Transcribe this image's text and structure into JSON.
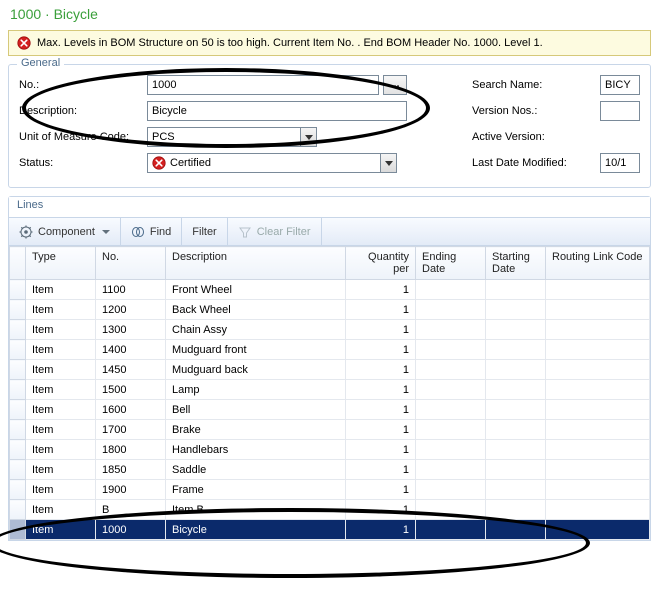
{
  "title": "1000 · Bicycle",
  "alert": "Max. Levels in BOM Structure on 50 is too high. Current Item No. . End BOM Header No. 1000. Level 1.",
  "general": {
    "legend": "General",
    "no_label": "No.:",
    "no_value": "1000",
    "description_label": "Description:",
    "description_value": "Bicycle",
    "uom_label": "Unit of Measure Code:",
    "uom_value": "PCS",
    "status_label": "Status:",
    "status_value": "Certified",
    "search_name_label": "Search Name:",
    "search_name_value": "BICY",
    "version_nos_label": "Version Nos.:",
    "version_nos_value": "",
    "active_version_label": "Active Version:",
    "active_version_value": "",
    "last_date_modified_label": "Last Date Modified:",
    "last_date_modified_value": "10/1"
  },
  "lines": {
    "legend": "Lines",
    "toolbar": {
      "component": "Component",
      "find": "Find",
      "filter": "Filter",
      "clear_filter": "Clear Filter"
    },
    "columns": {
      "type": "Type",
      "no": "No.",
      "description": "Description",
      "qty_per": "Quantity per",
      "ending_date": "Ending Date",
      "starting_date": "Starting Date",
      "routing_link_code": "Routing Link Code"
    },
    "rows": [
      {
        "type": "Item",
        "no": "1100",
        "description": "Front Wheel",
        "qty_per": "1",
        "ending_date": "",
        "starting_date": "",
        "routing": ""
      },
      {
        "type": "Item",
        "no": "1200",
        "description": "Back Wheel",
        "qty_per": "1",
        "ending_date": "",
        "starting_date": "",
        "routing": ""
      },
      {
        "type": "Item",
        "no": "1300",
        "description": "Chain Assy",
        "qty_per": "1",
        "ending_date": "",
        "starting_date": "",
        "routing": ""
      },
      {
        "type": "Item",
        "no": "1400",
        "description": "Mudguard front",
        "qty_per": "1",
        "ending_date": "",
        "starting_date": "",
        "routing": ""
      },
      {
        "type": "Item",
        "no": "1450",
        "description": "Mudguard back",
        "qty_per": "1",
        "ending_date": "",
        "starting_date": "",
        "routing": ""
      },
      {
        "type": "Item",
        "no": "1500",
        "description": "Lamp",
        "qty_per": "1",
        "ending_date": "",
        "starting_date": "",
        "routing": ""
      },
      {
        "type": "Item",
        "no": "1600",
        "description": "Bell",
        "qty_per": "1",
        "ending_date": "",
        "starting_date": "",
        "routing": ""
      },
      {
        "type": "Item",
        "no": "1700",
        "description": "Brake",
        "qty_per": "1",
        "ending_date": "",
        "starting_date": "",
        "routing": ""
      },
      {
        "type": "Item",
        "no": "1800",
        "description": "Handlebars",
        "qty_per": "1",
        "ending_date": "",
        "starting_date": "",
        "routing": ""
      },
      {
        "type": "Item",
        "no": "1850",
        "description": "Saddle",
        "qty_per": "1",
        "ending_date": "",
        "starting_date": "",
        "routing": ""
      },
      {
        "type": "Item",
        "no": "1900",
        "description": "Frame",
        "qty_per": "1",
        "ending_date": "",
        "starting_date": "",
        "routing": ""
      },
      {
        "type": "Item",
        "no": "B",
        "description": "Item B",
        "qty_per": "1",
        "ending_date": "",
        "starting_date": "",
        "routing": ""
      },
      {
        "type": "Item",
        "no": "1000",
        "description": "Bicycle",
        "qty_per": "1",
        "ending_date": "",
        "starting_date": "",
        "routing": "",
        "selected": true
      }
    ]
  }
}
